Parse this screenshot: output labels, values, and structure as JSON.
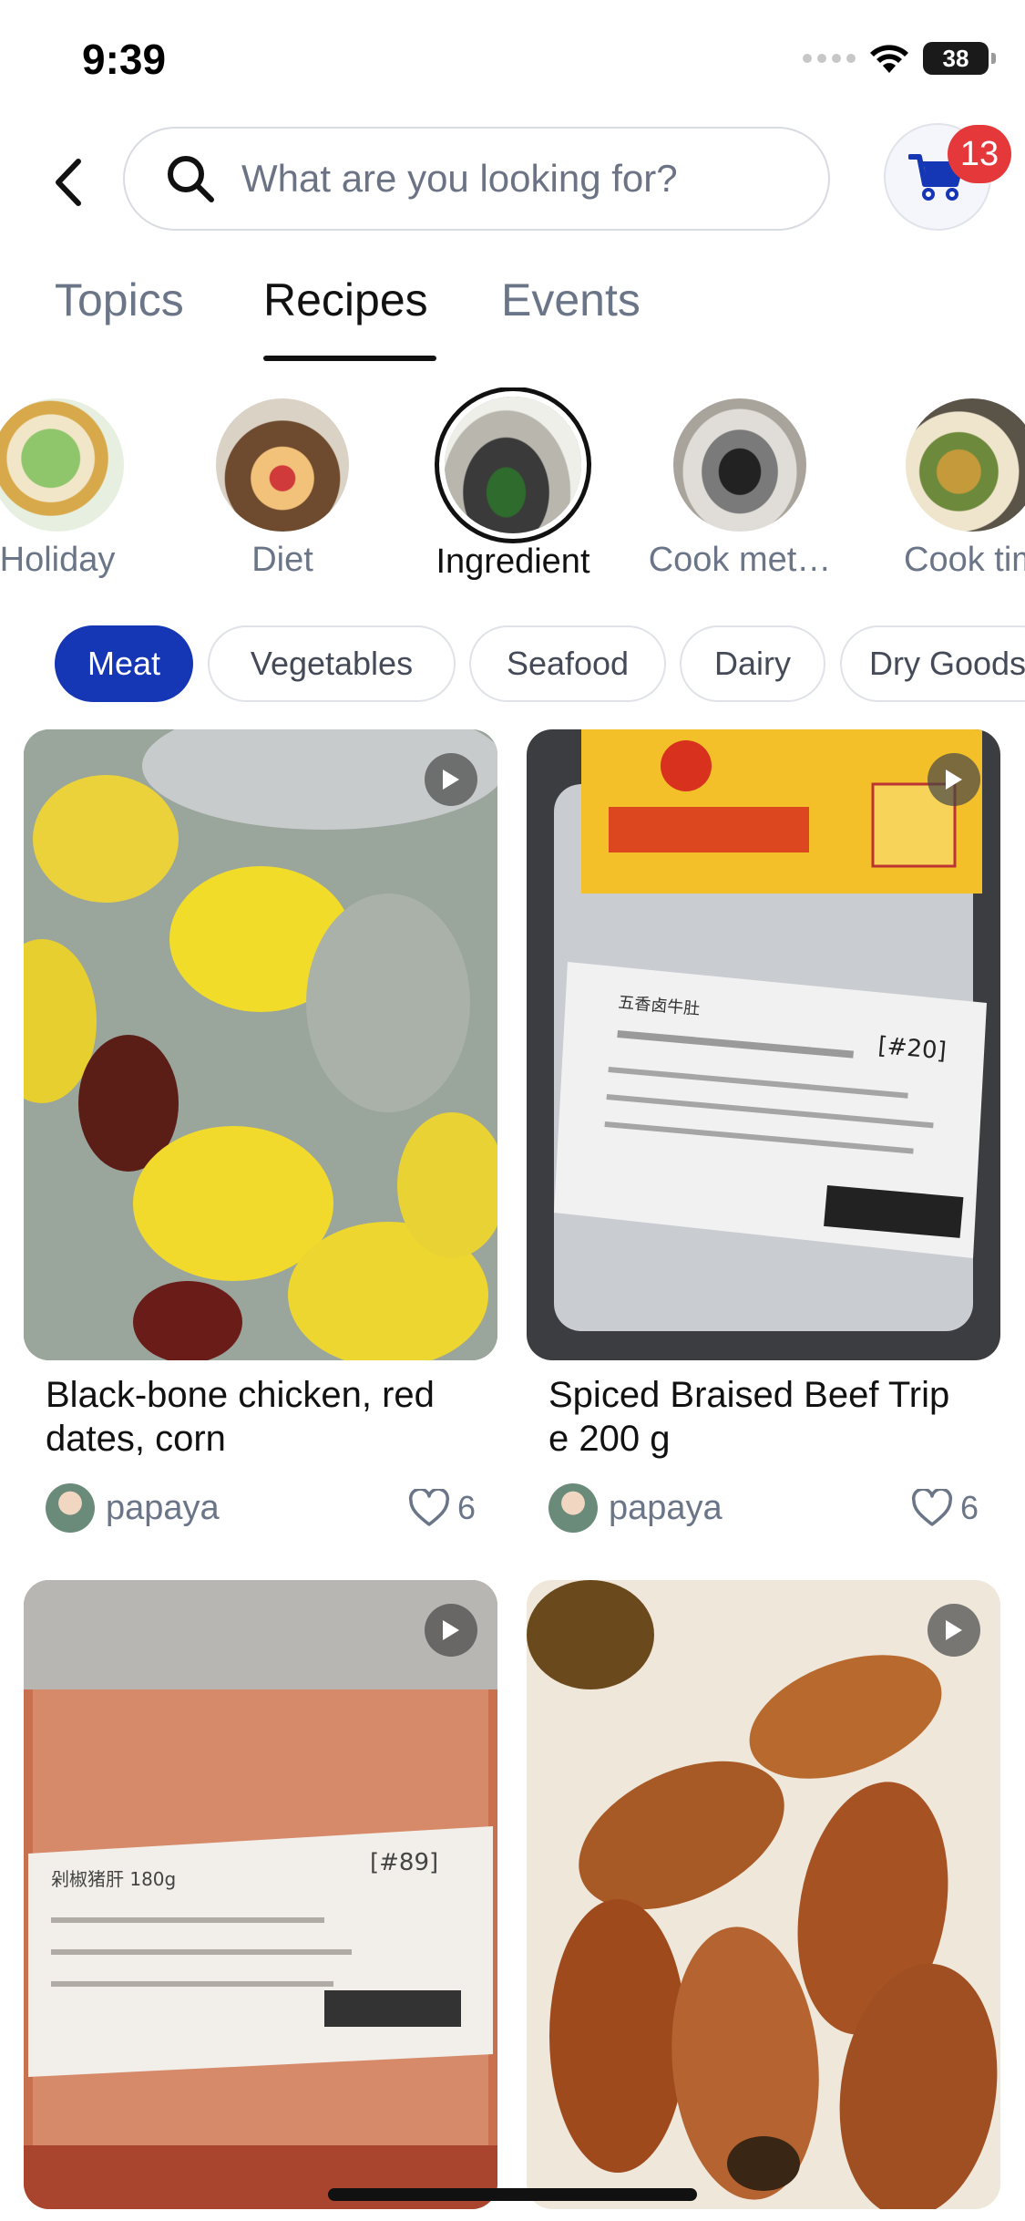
{
  "status_bar": {
    "time": "9:39",
    "battery": "38"
  },
  "header": {
    "search_placeholder": "What are you looking for?",
    "cart_count": "13"
  },
  "tabs": [
    {
      "label": "Topics",
      "active": false
    },
    {
      "label": "Recipes",
      "active": true
    },
    {
      "label": "Events",
      "active": false
    }
  ],
  "categories": [
    {
      "label": "Holiday"
    },
    {
      "label": "Diet"
    },
    {
      "label": "Ingredient",
      "active": true
    },
    {
      "label": "Cook met…"
    },
    {
      "label": "Cook tim"
    }
  ],
  "chips": [
    {
      "label": "Meat",
      "active": true
    },
    {
      "label": "Vegetables"
    },
    {
      "label": "Seafood"
    },
    {
      "label": "Dairy"
    },
    {
      "label": "Dry Goods"
    }
  ],
  "cards": [
    {
      "title": "Black-bone chicken, red dates, corn",
      "author": "papaya",
      "likes": "6",
      "video": true
    },
    {
      "title": "Spiced Braised Beef Trip e 200 g",
      "author": "papaya",
      "likes": "6",
      "video": true,
      "label_text": [
        "五香卤牛肚",
        "[#20]"
      ]
    },
    {
      "title": "",
      "author": "",
      "likes": "",
      "video": true,
      "label_text": [
        "剁椒猪肝 180g",
        "[#89]"
      ]
    },
    {
      "title": "",
      "author": "",
      "likes": "",
      "video": true
    }
  ],
  "colors": {
    "accent": "#1536b5",
    "badge": "#e5383b",
    "muted_text": "#6b7588"
  }
}
